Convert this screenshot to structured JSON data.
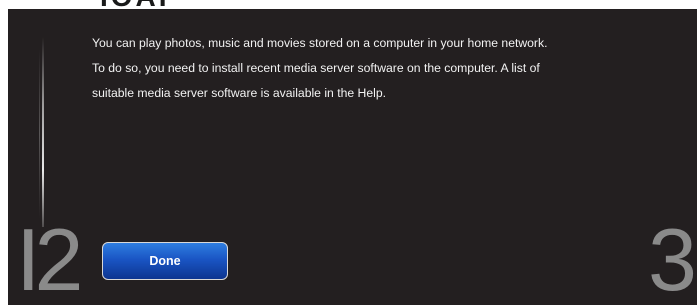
{
  "header": {
    "title_fragment": "IOAI"
  },
  "message": {
    "lines": [
      "You can play photos, music and movies stored on a computer in your home network.",
      "To do so, you need to install recent media server software on the computer. A list of",
      "suitable media server software is available in the Help."
    ]
  },
  "steps": {
    "current": "2",
    "current_prefix": "I",
    "next": "3"
  },
  "actions": {
    "done_label": "Done"
  },
  "colors": {
    "panel_background": "#231f20",
    "button_top": "#2f7ee0",
    "button_bottom": "#0d3590",
    "step_number": "#8a8a8a"
  }
}
